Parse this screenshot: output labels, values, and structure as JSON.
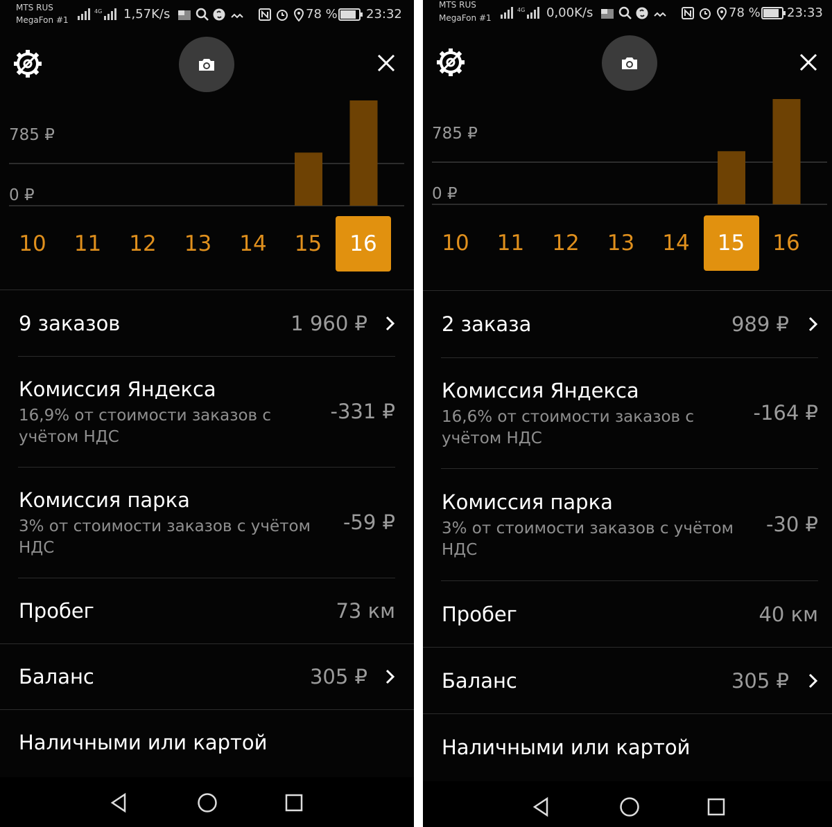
{
  "screens": [
    {
      "status": {
        "carrier1": "MTS RUS",
        "carrier2": "MegaFon #1",
        "speed": "1,57K/s",
        "battery": "78 %",
        "time": "23:32"
      },
      "chart": {
        "ylabel_top": "785 ₽",
        "ylabel_zero": "0 ₽"
      },
      "days": [
        "10",
        "11",
        "12",
        "13",
        "14",
        "15",
        "16"
      ],
      "selected_day": "16",
      "orders": {
        "title": "9 заказов",
        "value": "1 960 ₽"
      },
      "yandex_fee": {
        "title": "Комиссия Яндекса",
        "subtitle": "16,9% от стоимости заказов с учётом НДС",
        "value": "-331 ₽"
      },
      "park_fee": {
        "title": "Комиссия парка",
        "subtitle": "3% от стоимости заказов с учётом НДС",
        "value": "-59 ₽"
      },
      "mileage": {
        "title": "Пробег",
        "value": "73 км"
      },
      "balance": {
        "title": "Баланс",
        "value": "305 ₽"
      },
      "payment": {
        "title": "Наличными или картой"
      }
    },
    {
      "status": {
        "carrier1": "MTS RUS",
        "carrier2": "MegaFon #1",
        "speed": "0,00K/s",
        "battery": "78 %",
        "time": "23:33"
      },
      "chart": {
        "ylabel_top": "785 ₽",
        "ylabel_zero": "0 ₽"
      },
      "days": [
        "10",
        "11",
        "12",
        "13",
        "14",
        "15",
        "16"
      ],
      "selected_day": "15",
      "orders": {
        "title": "2 заказа",
        "value": "989 ₽"
      },
      "yandex_fee": {
        "title": "Комиссия Яндекса",
        "subtitle": "16,6% от стоимости заказов с учётом НДС",
        "value": "-164 ₽"
      },
      "park_fee": {
        "title": "Комиссия парка",
        "subtitle": "3% от стоимости заказов с учётом НДС",
        "value": "-30 ₽"
      },
      "mileage": {
        "title": "Пробег",
        "value": "40 км"
      },
      "balance": {
        "title": "Баланс",
        "value": "305 ₽"
      },
      "payment": {
        "title": "Наличными или картой"
      }
    }
  ],
  "chart_data": [
    {
      "type": "bar",
      "categories": [
        "10",
        "11",
        "12",
        "13",
        "14",
        "15",
        "16"
      ],
      "values": [
        0,
        0,
        0,
        0,
        0,
        989,
        1960
      ],
      "ylabel": "",
      "ylim": [
        0,
        1960
      ],
      "yticks": [
        "0 ₽",
        "785 ₽"
      ],
      "grid": true,
      "bar_color": "#6e4204"
    },
    {
      "type": "bar",
      "categories": [
        "10",
        "11",
        "12",
        "13",
        "14",
        "15",
        "16"
      ],
      "values": [
        0,
        0,
        0,
        0,
        0,
        989,
        1960
      ],
      "ylabel": "",
      "ylim": [
        0,
        1960
      ],
      "yticks": [
        "0 ₽",
        "785 ₽"
      ],
      "grid": true,
      "bar_color": "#6e4204"
    }
  ],
  "icons": {
    "settings": "gear-icon",
    "camera": "camera-icon",
    "close": "close-icon",
    "chevron": "chevron-right-icon",
    "back": "back-icon",
    "home": "home-icon",
    "recents": "recents-icon"
  },
  "colors": {
    "accent": "#e1910f",
    "bar": "#6e4204",
    "background": "#050505"
  }
}
